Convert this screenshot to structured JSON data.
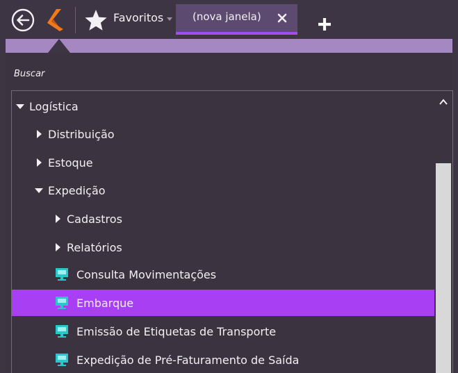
{
  "toolbar": {
    "favorites_label": "Favoritos",
    "tab_label": "(nova janela)"
  },
  "search": {
    "placeholder": "Buscar"
  },
  "tree": {
    "logistica": "Logística",
    "distribuicao": "Distribuição",
    "estoque": "Estoque",
    "expedicao": "Expedição",
    "cadastros": "Cadastros",
    "relatorios": "Relatórios",
    "consulta": "Consulta Movimentações",
    "embarque": "Embarque",
    "emissao": "Emissão de Etiquetas de Transporte",
    "pre_faturamento": "Expedição de Pré-Faturamento de Saída"
  },
  "icons": {
    "back": "back-arrow-icon",
    "logo": "app-logo-icon",
    "favorites": "star-icon",
    "tab_close": "close-icon",
    "new_tab": "plus-icon",
    "tree_item": "screen-item-icon"
  },
  "colors": {
    "background": "#3d3444",
    "accent": "#a83ff2",
    "tab_background": "#5d4a70",
    "header_band": "#a587c2",
    "logo_orange": "#f07a1a",
    "item_icon_teal": "#29c7c9"
  },
  "state": {
    "selected_item": "Embarque"
  }
}
